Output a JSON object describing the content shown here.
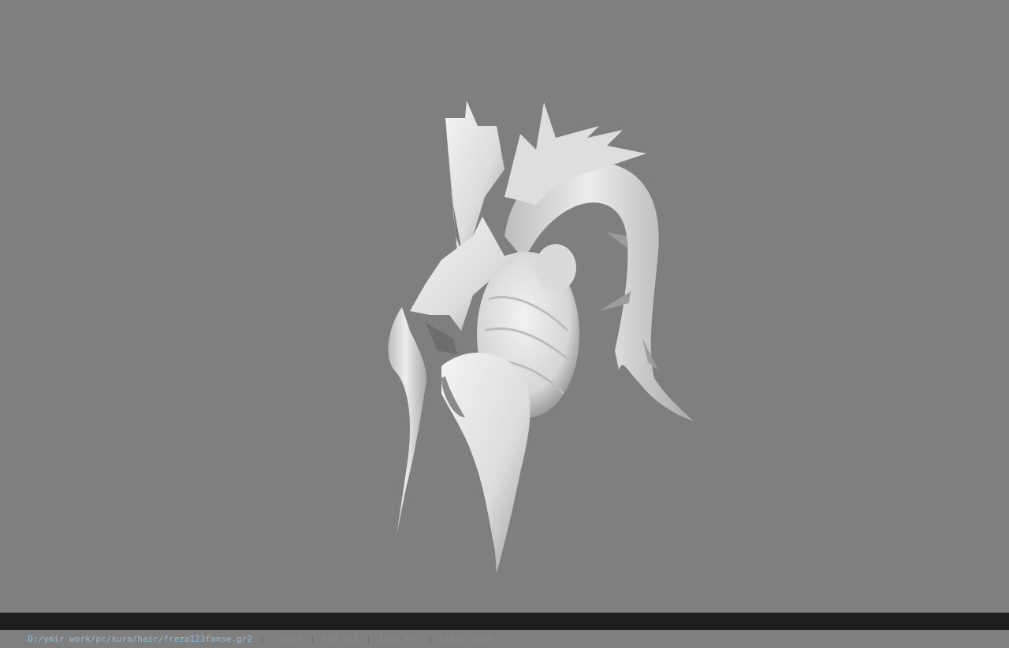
{
  "viewer": {
    "background_color": "#7f7f7f",
    "model_color": "#e6e6e6",
    "model_icon": "hair-mesh-model"
  },
  "status": {
    "file_path": "D:/ymir work/pc/sura/hair/freza123fanse.gr2",
    "separator": "|",
    "mesh_count": "1 mesh",
    "vertex_count": "984 vtx",
    "triangle_count": "1369 tri",
    "anim_status": "nincs anim"
  }
}
